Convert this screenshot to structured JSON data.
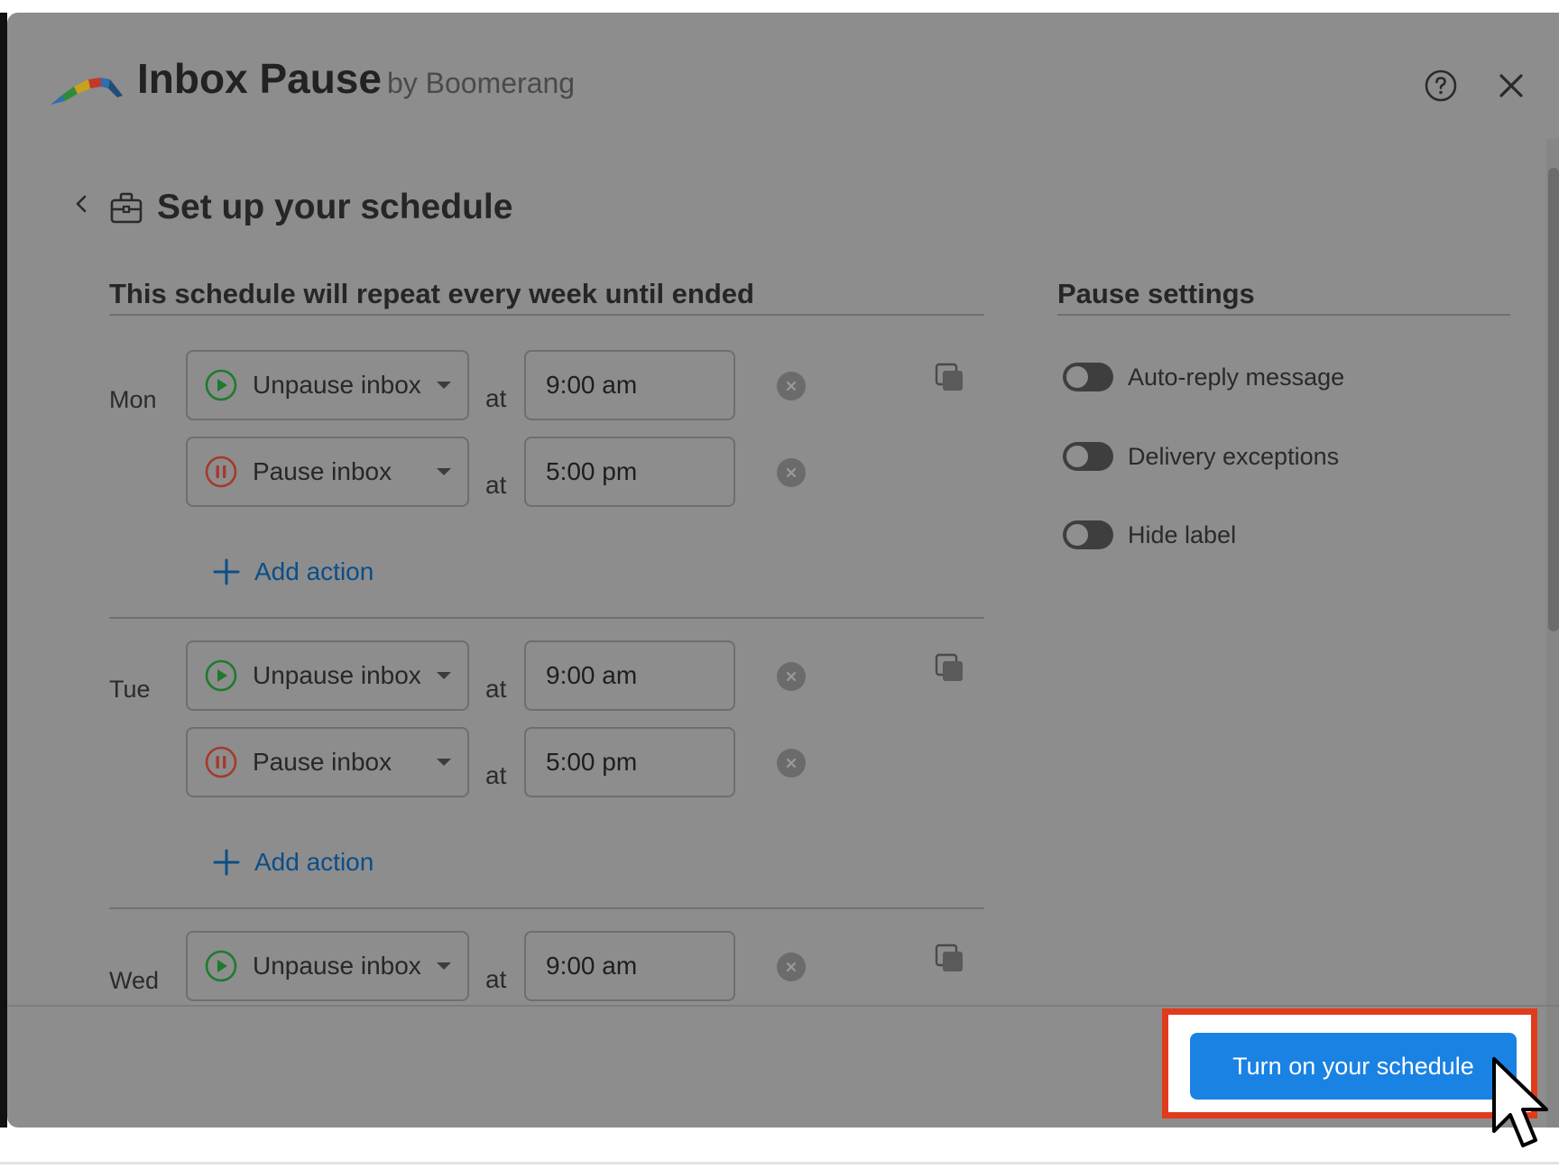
{
  "app": {
    "name": "Inbox Pause",
    "by": "by Boomerang",
    "help_icon": "help-circle-icon",
    "close_icon": "close-icon"
  },
  "page": {
    "title": "Set up your schedule",
    "back_icon": "chevron-left-icon",
    "title_icon": "briefcase-icon"
  },
  "schedule": {
    "heading": "This schedule will repeat every week until ended",
    "at_label": "at",
    "add_action_label": "Add action",
    "days": [
      {
        "day": "Mon",
        "actions": [
          {
            "type": "Unpause inbox",
            "icon": "play-circle-icon",
            "time": "9:00 am"
          },
          {
            "type": "Pause inbox",
            "icon": "pause-circle-icon",
            "time": "5:00 pm"
          }
        ]
      },
      {
        "day": "Tue",
        "actions": [
          {
            "type": "Unpause inbox",
            "icon": "play-circle-icon",
            "time": "9:00 am"
          },
          {
            "type": "Pause inbox",
            "icon": "pause-circle-icon",
            "time": "5:00 pm"
          }
        ]
      },
      {
        "day": "Wed",
        "actions": [
          {
            "type": "Unpause inbox",
            "icon": "play-circle-icon",
            "time": "9:00 am"
          }
        ]
      }
    ]
  },
  "pause_settings": {
    "heading": "Pause settings",
    "toggles": [
      {
        "label": "Auto-reply message",
        "on": false
      },
      {
        "label": "Delivery exceptions",
        "on": false
      },
      {
        "label": "Hide label",
        "on": false
      }
    ]
  },
  "footer": {
    "primary_label": "Turn on your schedule"
  },
  "colors": {
    "overlay": "#8d8d8d",
    "primary": "#1a82e2",
    "highlight": "#e03b1c",
    "unpause": "#1f7a2e",
    "pause": "#a43a2c",
    "link": "#0b4e88"
  }
}
